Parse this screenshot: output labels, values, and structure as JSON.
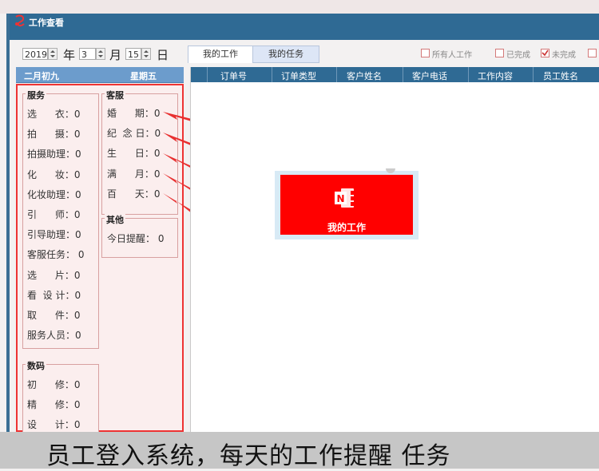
{
  "window": {
    "title": "工作查看"
  },
  "date": {
    "year": "2019",
    "year_label": "年",
    "month": "3",
    "month_label": "月",
    "day": "15",
    "day_label": "日"
  },
  "lunar": {
    "date": "二月初九",
    "weekday": "星期五"
  },
  "groups": {
    "service": {
      "legend": "服务",
      "items": [
        "选      衣：0",
        "拍      摄：0",
        "拍摄助理：0",
        "化      妆：0",
        "化妆助理：0",
        "引      师：0",
        "引导助理：0",
        "客服任务： 0",
        "选      片：0",
        "看  设 计：0",
        "取      件：0",
        "服务人员：0"
      ]
    },
    "customer": {
      "legend": "客服",
      "items": [
        "婚      期：0",
        "纪  念 日：0",
        "生      日：0",
        "满      月：0",
        "百      天：0"
      ]
    },
    "other": {
      "legend": "其他",
      "items": [
        "今日提醒： 0"
      ]
    },
    "digital": {
      "legend": "数码",
      "items": [
        "初      修：0",
        "精      修：0",
        "设      计：0"
      ]
    }
  },
  "tabs": [
    "我的工作",
    "我的任务"
  ],
  "filters": [
    {
      "label": "所有人工作",
      "checked": false
    },
    {
      "label": "已完成",
      "checked": false
    },
    {
      "label": "未完成",
      "checked": true
    }
  ],
  "table": {
    "columns": [
      "订单号",
      "订单类型",
      "客户姓名",
      "客户电话",
      "工作内容",
      "员工姓名"
    ],
    "rows": []
  },
  "tile": {
    "label": "我的工作",
    "icon": "onenote-icon",
    "color": "#ff0000"
  },
  "caption": "员工登入系统，每天的工作提醒 任务",
  "colors": {
    "titlebar": "#2f6a94",
    "accent": "#ff0000",
    "lunar_bar": "#6c9ccc",
    "header": "#2f6a94"
  }
}
